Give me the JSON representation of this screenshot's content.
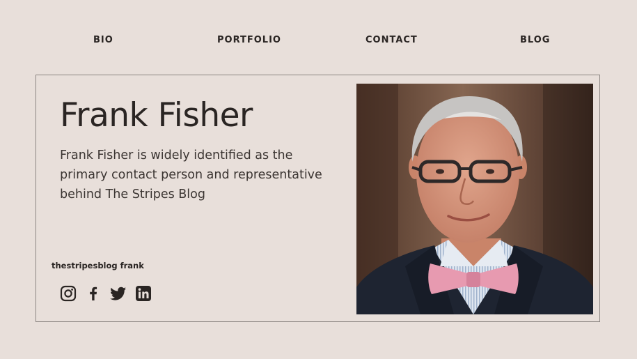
{
  "nav": {
    "items": [
      {
        "label": "BIO"
      },
      {
        "label": "PORTFOLIO"
      },
      {
        "label": "CONTACT"
      },
      {
        "label": "BLOG"
      }
    ]
  },
  "profile": {
    "name": "Frank Fisher",
    "bio": "Frank Fisher is widely identified as the primary contact person and representative behind The Stripes Blog",
    "handle": "thestripesblog frank"
  },
  "social": {
    "icons": [
      "instagram-icon",
      "facebook-icon",
      "twitter-icon",
      "linkedin-icon"
    ]
  },
  "colors": {
    "background": "#e8dfda",
    "text": "#2a2523",
    "border": "#8a8480"
  }
}
